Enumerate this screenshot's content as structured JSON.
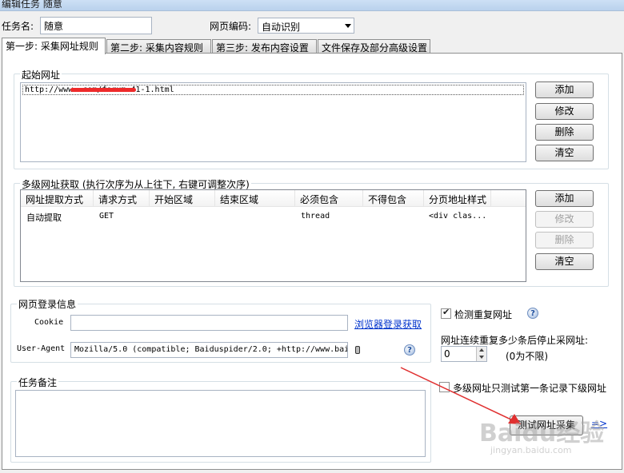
{
  "window": {
    "title": "编辑任务 随意"
  },
  "task": {
    "name_label": "任务名:",
    "name_value": "随意",
    "encoding_label": "网页编码:",
    "encoding_value": "自动识别"
  },
  "tabs": [
    {
      "label": "第一步: 采集网址规则",
      "active": true
    },
    {
      "label": "第二步: 采集内容规则",
      "active": false
    },
    {
      "label": "第三步: 发布内容设置",
      "active": false
    },
    {
      "label": "文件保存及部分高级设置",
      "active": false
    }
  ],
  "start_urls": {
    "title": "起始网址",
    "items": [
      "http://www.                     com/forum-41-1.html"
    ],
    "buttons": {
      "add": "添加",
      "edit": "修改",
      "delete": "删除",
      "clear": "清空"
    }
  },
  "multilevel": {
    "title": "多级网址获取 (执行次序为从上往下, 右键可调整次序)",
    "columns": [
      "网址提取方式",
      "请求方式",
      "开始区域",
      "结束区域",
      "必须包含",
      "不得包含",
      "分页地址样式"
    ],
    "rows": [
      [
        "自动提取",
        "GET",
        "",
        "",
        "thread",
        "",
        "<div clas..."
      ]
    ],
    "buttons": {
      "add": "添加",
      "edit": "修改",
      "delete": "删除",
      "clear": "清空"
    }
  },
  "login": {
    "title": "网页登录信息",
    "cookie_label": "Cookie",
    "cookie_value": "",
    "browser_link": "浏览器登录获取",
    "ua_label": "User-Agent",
    "ua_value": "Mozilla/5.0 (compatible; Baiduspider/2.0; +http://www.bai"
  },
  "options": {
    "check_dup_label": "检测重复网址",
    "check_dup_checked": true,
    "repeat_label": "网址连续重复多少条后停止采网址:",
    "repeat_value": "0",
    "repeat_hint": "(0为不限)",
    "test_first_label": "多级网址只测试第一条记录下级网址",
    "test_first_checked": false
  },
  "notes": {
    "title": "任务备注",
    "value": ""
  },
  "actions": {
    "test_button": "测试网址采集",
    "next_arrow": "=>"
  },
  "watermark": {
    "brand": "Baidu经验",
    "url": "jingyan.baidu.com"
  },
  "colors": {
    "arrow": "#e03030",
    "link": "#0033cc",
    "redact": "#ee2a2a"
  }
}
